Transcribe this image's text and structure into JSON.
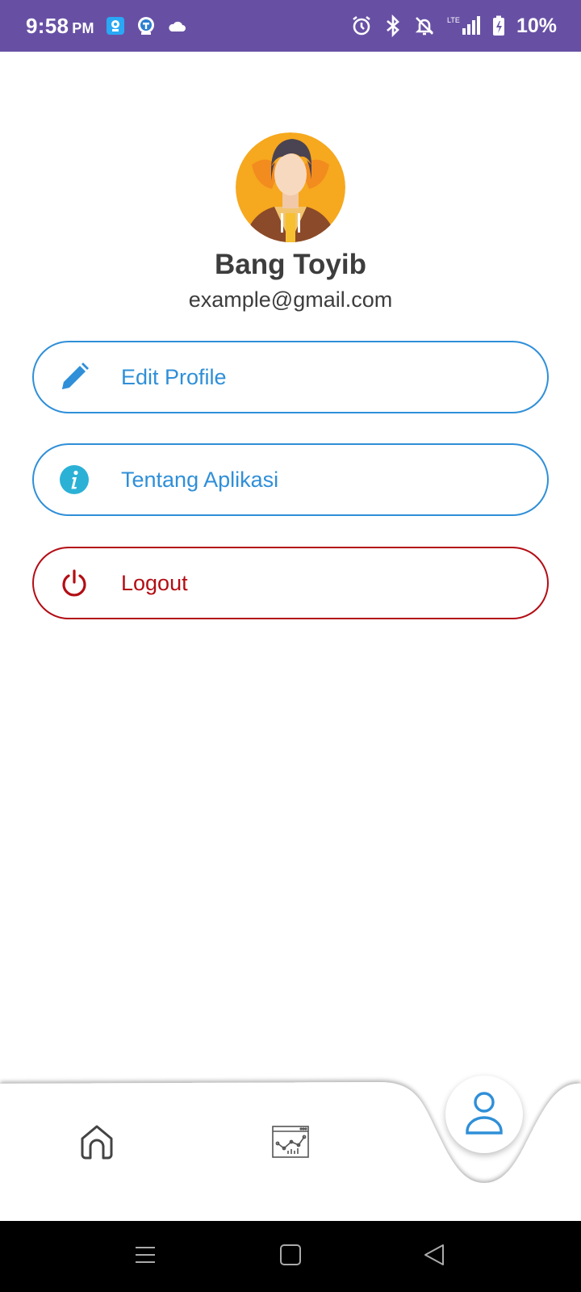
{
  "status_bar": {
    "time": "9:58",
    "ampm": "PM",
    "battery": "10%",
    "network": "LTE",
    "icons_left": [
      "app-icon-1",
      "app-icon-2",
      "cloud-icon"
    ],
    "icons_right": [
      "alarm-icon",
      "bluetooth-icon",
      "notifications-off-icon",
      "signal-icon",
      "battery-charging-icon"
    ]
  },
  "profile": {
    "name": "Bang Toyib",
    "email": "example@gmail.com"
  },
  "menu": {
    "edit_profile": "Edit Profile",
    "about_app": "Tentang Aplikasi",
    "logout": "Logout"
  },
  "bottom_nav": {
    "items": [
      "home-icon",
      "chart-icon",
      "profile-icon"
    ],
    "active": "profile-icon"
  },
  "colors": {
    "status_bar": "#6750a4",
    "accent_blue": "#2f8fd8",
    "info_cyan": "#2bb1d6",
    "logout_red": "#b30d14",
    "text_dark": "#3d3d3d"
  }
}
